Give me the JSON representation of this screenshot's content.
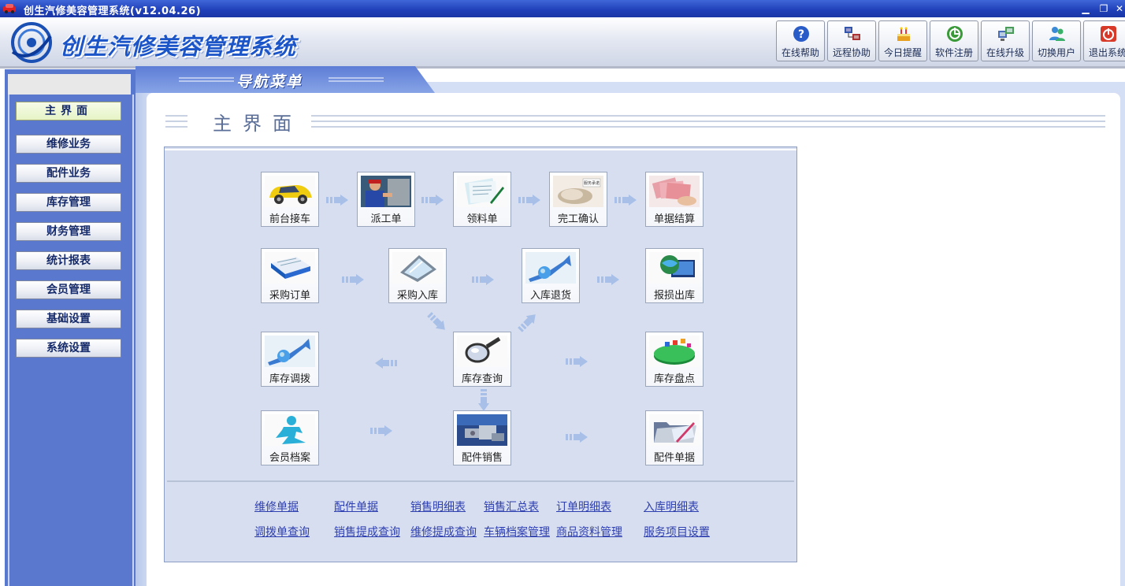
{
  "window": {
    "title": "创生汽修美容管理系统(v12.04.26)"
  },
  "header": {
    "app_title": "创生汽修美容管理系统",
    "toolbar": [
      {
        "label": "在线帮助",
        "icon": "help-icon"
      },
      {
        "label": "远程协助",
        "icon": "remote-assist-icon"
      },
      {
        "label": "今日提醒",
        "icon": "cake-icon"
      },
      {
        "label": "软件注册",
        "icon": "register-icon"
      },
      {
        "label": "在线升级",
        "icon": "upgrade-icon"
      },
      {
        "label": "切换用户",
        "icon": "switch-user-icon"
      },
      {
        "label": "退出系统",
        "icon": "exit-icon"
      }
    ]
  },
  "nav": {
    "banner_title": "导航菜单",
    "items": [
      {
        "label": "主界面"
      },
      {
        "label": "维修业务"
      },
      {
        "label": "配件业务"
      },
      {
        "label": "库存管理"
      },
      {
        "label": "财务管理"
      },
      {
        "label": "统计报表"
      },
      {
        "label": "会员管理"
      },
      {
        "label": "基础设置"
      },
      {
        "label": "系统设置"
      }
    ],
    "active_index": 0
  },
  "main": {
    "page_title": "主界面",
    "flow": {
      "row1": [
        {
          "label": "前台接车",
          "icon": "car-icon"
        },
        {
          "label": "派工单",
          "icon": "mechanic-icon"
        },
        {
          "label": "领料单",
          "icon": "document-pen-icon"
        },
        {
          "label": "完工确认",
          "icon": "handshake-icon"
        },
        {
          "label": "单据结算",
          "icon": "cash-icon"
        }
      ],
      "row2": [
        {
          "label": "采购订单",
          "icon": "book-icon"
        },
        {
          "label": "采购入库",
          "icon": "tablet-icon"
        },
        {
          "label": "入库退货",
          "icon": "chart-arrow-icon"
        },
        {
          "label": "报损出库",
          "icon": "globe-monitor-icon"
        }
      ],
      "row3": [
        {
          "label": "库存调拨",
          "icon": "chart-arrow-icon"
        },
        {
          "label": "库存查询",
          "icon": "magnifier-icon"
        },
        {
          "label": "库存盘点",
          "icon": "pie-chart-icon"
        }
      ],
      "row4": [
        {
          "label": "会员档案",
          "icon": "runner-icon"
        },
        {
          "label": "配件销售",
          "icon": "parts-icon"
        },
        {
          "label": "配件单据",
          "icon": "folder-icon"
        }
      ]
    },
    "links": {
      "row1": [
        "维修单据",
        "配件单据",
        "销售明细表",
        "销售汇总表",
        "订单明细表",
        "入库明细表"
      ],
      "row2": [
        "调拨单查询",
        "销售提成查询",
        "维修提成查询",
        "车辆档案管理",
        "商品资料管理",
        "服务项目设置"
      ]
    }
  }
}
